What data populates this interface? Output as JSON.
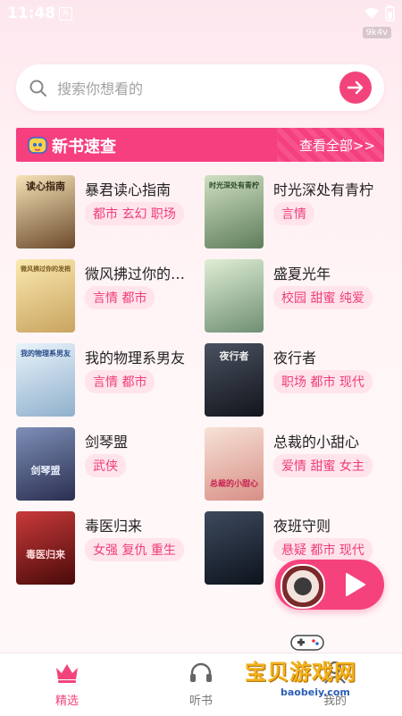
{
  "status": {
    "time": "11:48",
    "badge": "A",
    "version": "9k4v"
  },
  "search": {
    "placeholder": "搜索你想看的"
  },
  "section": {
    "title": "新书速查",
    "more": "查看全部>>"
  },
  "books": [
    {
      "title": "暴君读心指南",
      "tags": "都市 玄幻 职场",
      "cover_text": "读心指南",
      "cover_color": "#6b4a2b"
    },
    {
      "title": "时光深处有青柠",
      "tags": "言情",
      "cover_text": "时光深处有青柠",
      "cover_color": "#5e7d5a"
    },
    {
      "title": "微风拂过你的…",
      "tags": "言情 都市",
      "cover_text": "微风拂过你的发梢",
      "cover_color": "#c9a45f"
    },
    {
      "title": "盛夏光年",
      "tags": "校园 甜蜜 纯爱",
      "cover_text": "",
      "cover_color": "#6f8f73"
    },
    {
      "title": "我的物理系男友",
      "tags": "言情 都市",
      "cover_text": "我的物理系男友",
      "cover_color": "#8fb0cc"
    },
    {
      "title": "夜行者",
      "tags": "职场 都市 现代",
      "cover_text": "夜行者",
      "cover_color": "#2b2f3a"
    },
    {
      "title": "剑琴盟",
      "tags": "武侠",
      "cover_text": "剑琴盟",
      "cover_color": "#3c4a6e"
    },
    {
      "title": "总裁的小甜心",
      "tags": "爱情 甜蜜 女主",
      "cover_text": "总裁的小甜心",
      "cover_color": "#e6b1a0"
    },
    {
      "title": "毒医归来",
      "tags": "女强 复仇 重生",
      "cover_text": "毒医归来",
      "cover_color": "#8a1a1a"
    },
    {
      "title": "夜班守则",
      "tags": "悬疑 都市 现代",
      "cover_text": "",
      "cover_color": "#1f2a38"
    }
  ],
  "tabs": [
    {
      "label": "精选",
      "icon": "crown-icon",
      "active": true
    },
    {
      "label": "听书",
      "icon": "headphones-icon",
      "active": false
    },
    {
      "label": "我的",
      "icon": "user-icon",
      "active": false
    }
  ],
  "watermark": {
    "text": "宝贝游戏网",
    "url": "baobeiy.com"
  },
  "colors": {
    "accent": "#f2447b",
    "tag_bg": "#ffe4ec",
    "tag_text": "#ef3d78"
  }
}
